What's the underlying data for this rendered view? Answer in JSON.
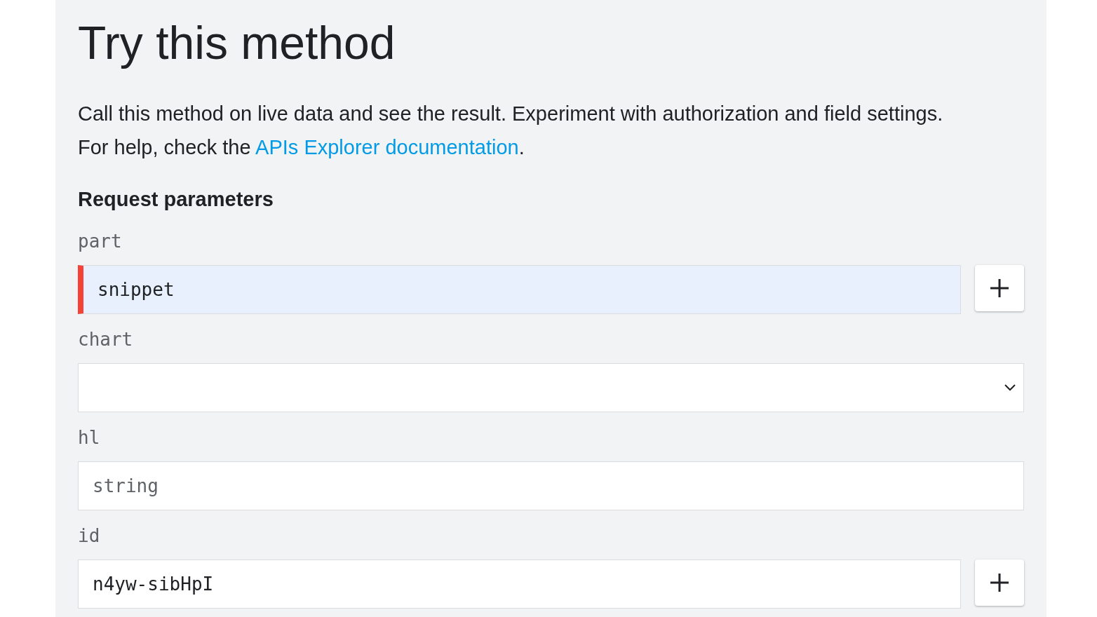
{
  "title": "Try this method",
  "description": {
    "text": "Call this method on live data and see the result. Experiment with authorization and field settings. For help, check the ",
    "link": "APIs Explorer documentation",
    "end": "."
  },
  "section_heading": "Request parameters",
  "parameters": [
    {
      "name": "part",
      "kind": "text",
      "value": "snippet",
      "required": true,
      "highlighted": true,
      "repeatable": true
    },
    {
      "name": "chart",
      "kind": "select",
      "required": false,
      "highlighted": false,
      "repeatable": false
    },
    {
      "name": "hl",
      "kind": "text",
      "placeholder": "string",
      "required": false,
      "highlighted": false,
      "repeatable": false
    },
    {
      "name": "id",
      "kind": "text",
      "value": "n4yw-sibHpI",
      "required": false,
      "highlighted": false,
      "repeatable": true
    }
  ]
}
